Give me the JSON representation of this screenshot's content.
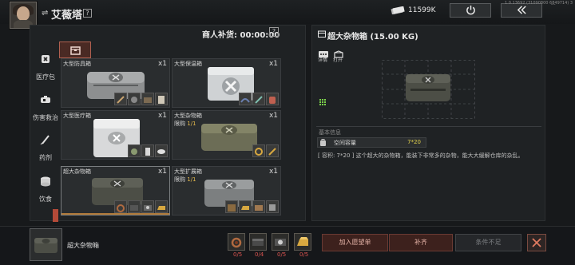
{
  "header": {
    "trader_name": "艾薇塔",
    "help": "?",
    "money": "11599K",
    "version": "1.0.13692 (31090800 6849714) 3",
    "phone_status": "..."
  },
  "shop": {
    "restock_label": "商人补货: 00:00:00",
    "restock_help": "?"
  },
  "categories": [
    {
      "label": "医疗包",
      "icon": "medkit-icon"
    },
    {
      "label": "伤害救治",
      "icon": "bandage-icon"
    },
    {
      "label": "药剂",
      "icon": "syringe-icon"
    },
    {
      "label": "饮食",
      "icon": "food-icon"
    }
  ],
  "items": [
    {
      "name": "大型防具箱",
      "qty": "x1",
      "limit_prefix": "",
      "limit_value": "",
      "box": "gray"
    },
    {
      "name": "大型保温箱",
      "qty": "x1",
      "limit_prefix": "",
      "limit_value": "",
      "box": "white"
    },
    {
      "name": "大型医疗箱",
      "qty": "x1",
      "limit_prefix": "",
      "limit_value": "",
      "box": "white-red"
    },
    {
      "name": "大型杂物箱",
      "qty": "x1",
      "limit_prefix": "限购 ",
      "limit_value": "1/1",
      "box": "olive"
    },
    {
      "name": "超大杂物箱",
      "qty": "x1",
      "limit_prefix": "",
      "limit_value": "",
      "box": "dark"
    },
    {
      "name": "大型扩展箱",
      "qty": "x1",
      "limit_prefix": "限购 ",
      "limit_value": "1/1",
      "box": "gray-dark"
    }
  ],
  "detail": {
    "title": "超大杂物箱 (15.00 KG)",
    "detail_label": "详情",
    "open_label": "打开",
    "basic_info": "基本信息",
    "capacity_label": "空间容量",
    "capacity_value": "7*20",
    "description": "[ 容积: 7*20 ] 这个超大的杂物箱，能装下非常多的杂物，能大大缓解仓库的杂乱。"
  },
  "bottom": {
    "selected_name": "超大杂物箱",
    "materials": [
      {
        "icon": "pendant-icon",
        "count": "0/5",
        "ok": false
      },
      {
        "icon": "fabric-icon",
        "count": "0/4",
        "ok": false
      },
      {
        "icon": "camera-icon",
        "count": "0/5",
        "ok": false
      },
      {
        "icon": "gold-bar-icon",
        "count": "0/5",
        "ok": false
      }
    ],
    "wish_label": "加入愿望单",
    "restock_label": "补齐",
    "insufficient_label": "条件不足"
  },
  "colors": {
    "accent_red": "#b44a38",
    "limit_gold": "#e3b94c",
    "value_yellow": "#e3d34c",
    "missing_red": "#d9534f"
  }
}
